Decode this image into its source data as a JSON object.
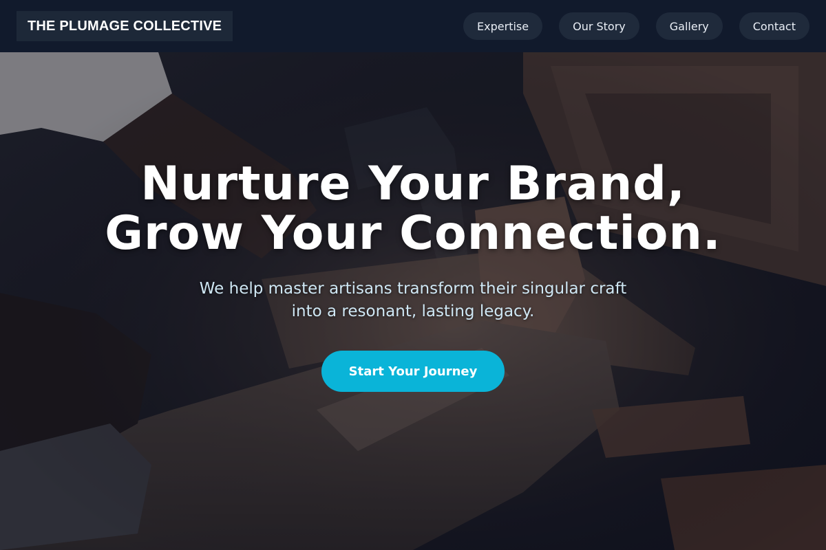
{
  "header": {
    "logo": "THE PLUMAGE COLLECTIVE",
    "nav": [
      {
        "label": "Expertise"
      },
      {
        "label": "Our Story"
      },
      {
        "label": "Gallery"
      },
      {
        "label": "Contact"
      }
    ]
  },
  "hero": {
    "headline_line1": "Nurture Your Brand,",
    "headline_line2": "Grow Your Connection.",
    "subtitle_line1": "We help master artisans transform their singular craft",
    "subtitle_line2": "into a resonant, lasting legacy.",
    "cta_label": "Start Your Journey",
    "background_image": "artisan-woodworking-photo"
  },
  "colors": {
    "header_bg": "#111a2c",
    "nav_pill_bg": "#1f2a3b",
    "cta_bg": "#0ab4d8",
    "subtitle": "#cfe7f4"
  }
}
